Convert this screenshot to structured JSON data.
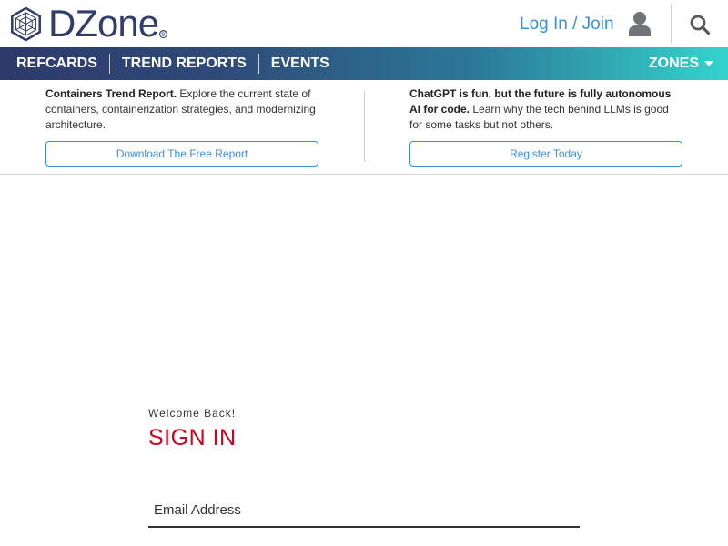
{
  "header": {
    "logo_text": "DZone",
    "logo_reg": "®",
    "login_label": "Log In / Join",
    "icons": [
      "user-icon",
      "search-icon"
    ]
  },
  "nav": {
    "items": [
      {
        "label": "REFCARDS"
      },
      {
        "label": "TREND REPORTS"
      },
      {
        "label": "EVENTS"
      }
    ],
    "zones_label": "ZONES"
  },
  "promos": [
    {
      "title": "Containers Trend Report.",
      "text": " Explore the current state of containers, containerization strategies, and modernizing architecture.",
      "button": "Download The Free Report"
    },
    {
      "title": "ChatGPT is fun, but the future is fully autonomous AI for code.",
      "text": " Learn why the tech behind LLMs is good for some tasks but not others.",
      "button": "Register Today"
    }
  ],
  "signin": {
    "welcome": "Welcome Back!",
    "title": "SIGN IN",
    "email_placeholder": "Email Address"
  },
  "colors": {
    "brand_navy": "#313d6c",
    "link_blue": "#3a8fd9",
    "signin_red": "#d0021b",
    "nav_gradient_start": "#2c3a6b",
    "nav_gradient_end": "#35d3cc"
  }
}
